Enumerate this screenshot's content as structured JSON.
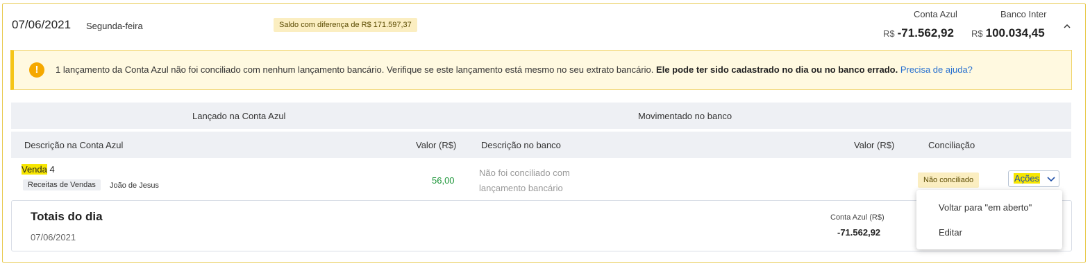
{
  "header": {
    "date": "07/06/2021",
    "weekday": "Segunda-feira",
    "diff_badge": "Saldo com diferença de R$ 171.597,37",
    "conta_azul_label": "Conta Azul",
    "banco_label": "Banco Inter",
    "currency": "R$",
    "conta_azul_value": "-71.562,92",
    "banco_value": "100.034,45"
  },
  "alert": {
    "text": "1 lançamento da Conta Azul não foi conciliado com nenhum lançamento bancário. Verifique se este lançamento está mesmo no seu extrato bancário.",
    "bold": "Ele pode ter sido cadastrado no dia ou no banco errado.",
    "link": "Precisa de ajuda?"
  },
  "table": {
    "group_left": "Lançado na Conta Azul",
    "group_right": "Movimentado no banco",
    "columns": [
      "Descrição na Conta Azul",
      "Valor (R$)",
      "Descrição no banco",
      "Valor (R$)",
      "Conciliação"
    ],
    "row": {
      "desc_highlight": "Venda",
      "desc_rest": " 4",
      "category": "Receitas de Vendas",
      "person": "João de Jesus",
      "value": "56,00",
      "bank_desc": "Não foi conciliado com lançamento bancário",
      "status": "Não conciliado",
      "actions_label": "Ações"
    }
  },
  "totals": {
    "title": "Totais do dia",
    "date": "07/06/2021",
    "conta_azul_label": "Conta Azul (R$)",
    "conta_azul_value": "-71.562,92"
  },
  "menu": {
    "items": [
      "Voltar para \"em aberto\"",
      "Editar"
    ]
  },
  "colors": {
    "accent_yellow": "#f5c518",
    "highlight": "#f7e600",
    "positive": "#1a9436",
    "link": "#2a72d0"
  }
}
